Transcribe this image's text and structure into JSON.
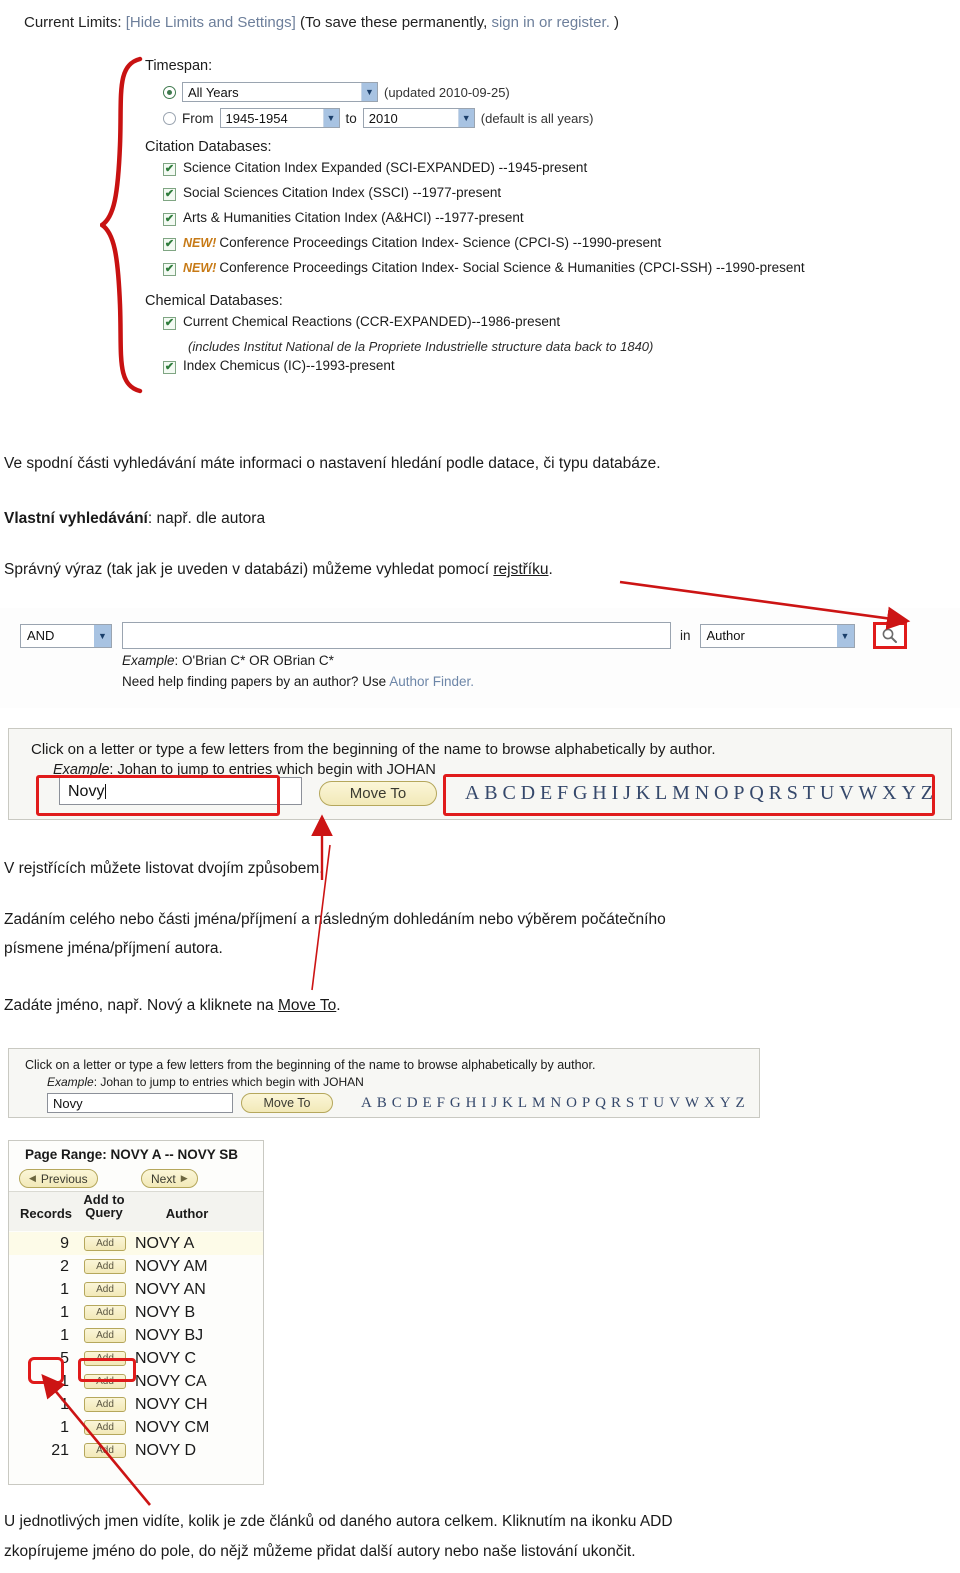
{
  "limits_panel": {
    "current_limits_label": "Current Limits:",
    "hide_limits_link": "[Hide Limits and Settings]",
    "save_note_prefix": "(To save these permanently,",
    "sign_in_link": "sign in or register.",
    "save_note_suffix": ")",
    "timespan": {
      "title": "Timespan:",
      "all_years_selected": "All Years",
      "updated_note": "(updated 2010-09-25)",
      "from_label": "From",
      "from_value": "1945-1954",
      "to_label": "to",
      "to_value": "2010",
      "default_note": "(default is all years)"
    },
    "citation_databases": {
      "title": "Citation Databases:",
      "items": [
        {
          "checked": true,
          "new": false,
          "label": "Science Citation Index Expanded (SCI-EXPANDED) --1945-present"
        },
        {
          "checked": true,
          "new": false,
          "label": "Social Sciences Citation Index (SSCI) --1977-present"
        },
        {
          "checked": true,
          "new": false,
          "label": "Arts & Humanities Citation Index (A&HCI) --1977-present"
        },
        {
          "checked": true,
          "new": true,
          "label": "Conference Proceedings Citation Index- Science (CPCI-S) --1990-present"
        },
        {
          "checked": true,
          "new": true,
          "label": "Conference Proceedings Citation Index- Social Science & Humanities (CPCI-SSH) --1990-present"
        }
      ],
      "new_tag": "NEW!"
    },
    "chemical_databases": {
      "title": "Chemical Databases:",
      "item_1": "Current Chemical Reactions (CCR-EXPANDED)--1986-present",
      "item_1_sub": "(includes Institut National de la Propriete Industrielle structure data back to 1840)",
      "item_2": "Index Chemicus (IC)--1993-present"
    }
  },
  "body_text": {
    "para_1": "Ve spodní části vyhledávání máte informaci o nastavení hledání podle datace, či typu databáze.",
    "para_2_bold": "Vlastní vyhledávání",
    "para_2_rest": ": např. dle autora",
    "para_3_pre": "Správný výraz (tak jak je uveden v databázi) můžeme vyhledat pomocí ",
    "para_3_link": "rejstříku",
    "para_3_post": ".",
    "para_4": "V rejstřících můžete listovat dvojím způsobem.",
    "para_5": "Zadáním celého nebo části jména/příjmení a následným dohledáním nebo výběrem počátečního",
    "para_5b": "písmene jména/příjmení autora.",
    "para_6_pre": "Zadáte jméno, např. Nový a kliknete na ",
    "para_6_link": "Move To",
    "para_6_post": ".",
    "para_7a": "U jednotlivých jmen vidíte, kolik je zde článků od daného autora celkem. Kliknutím na ikonku ADD",
    "para_7b": "zkopírujeme jméno do pole, do nějž můžeme přidat další autory nebo naše listování ukončit."
  },
  "search_row": {
    "boolean_value": "AND",
    "query_value": "",
    "in_label": "in",
    "field_value": "Author",
    "search_icon": "magnifier-icon",
    "example_label": "Example",
    "example_text": ": O'Brian C* OR OBrian C*",
    "help_text": "Need help finding papers by an author? Use ",
    "author_finder_link": "Author Finder."
  },
  "browse_widget": {
    "instruction": "Click on a letter or type a few letters from the beginning of the name to browse alphabetically by author.",
    "example_label": "Example",
    "example_text": ": Johan to jump to entries which begin with JOHAN",
    "name_value": "Novy",
    "move_to_label": "Move To",
    "letters": [
      "A",
      "B",
      "C",
      "D",
      "E",
      "F",
      "G",
      "H",
      "I",
      "J",
      "K",
      "L",
      "M",
      "N",
      "O",
      "P",
      "Q",
      "R",
      "S",
      "T",
      "U",
      "V",
      "W",
      "X",
      "Y",
      "Z"
    ]
  },
  "results": {
    "page_range": "Page Range: NOVY A -- NOVY SB",
    "previous_label": "Previous",
    "next_label": "Next",
    "headers": {
      "records": "Records",
      "add_to_query": "Add to Query",
      "author": "Author"
    },
    "add_label": "Add",
    "rows": [
      {
        "records": "9",
        "author": "NOVY A"
      },
      {
        "records": "2",
        "author": "NOVY AM"
      },
      {
        "records": "1",
        "author": "NOVY AN"
      },
      {
        "records": "1",
        "author": "NOVY B"
      },
      {
        "records": "1",
        "author": "NOVY BJ"
      },
      {
        "records": "5",
        "author": "NOVY C"
      },
      {
        "records": "1",
        "author": "NOVY CA"
      },
      {
        "records": "1",
        "author": "NOVY CH"
      },
      {
        "records": "1",
        "author": "NOVY CM"
      },
      {
        "records": "21",
        "author": "NOVY D"
      }
    ]
  },
  "annotation_colors": {
    "highlight_red": "#e01b1b",
    "brace_red": "#c81212",
    "link_blue": "#6d7f9b"
  }
}
